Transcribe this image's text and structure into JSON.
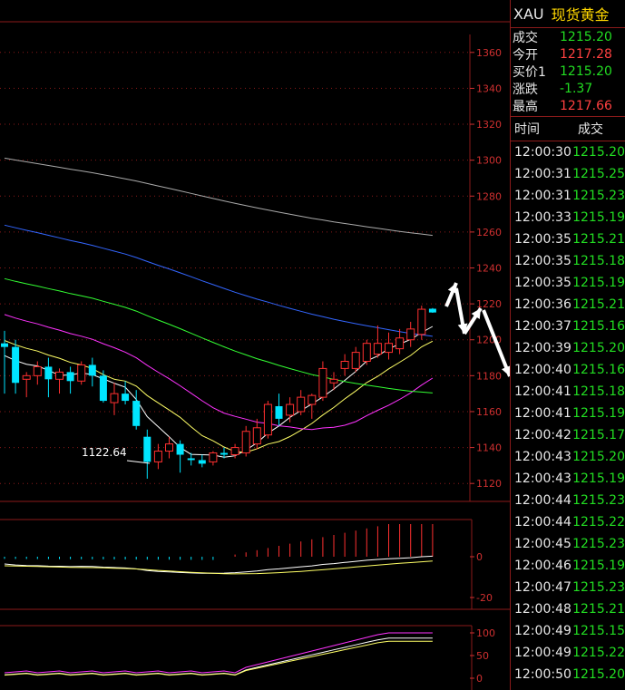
{
  "chart": {
    "price_ticks": [
      "1360",
      "1340",
      "1320",
      "1300",
      "1280",
      "1260",
      "1240",
      "1220",
      "1200",
      "1180",
      "1160",
      "1140",
      "1120"
    ],
    "low_label": "1122.64",
    "macd_ticks": [
      "0",
      "-20"
    ],
    "kdj_ticks": [
      "100",
      "50",
      "0"
    ]
  },
  "chart_data": {
    "type": "candlestick",
    "price_range": [
      1110,
      1370
    ],
    "candles": [
      {
        "o": 1198,
        "h": 1205,
        "l": 1170,
        "c": 1196
      },
      {
        "o": 1196,
        "h": 1200,
        "l": 1170,
        "c": 1176
      },
      {
        "o": 1178,
        "h": 1182,
        "l": 1168,
        "c": 1180
      },
      {
        "o": 1180,
        "h": 1188,
        "l": 1175,
        "c": 1185
      },
      {
        "o": 1185,
        "h": 1190,
        "l": 1168,
        "c": 1178
      },
      {
        "o": 1178,
        "h": 1184,
        "l": 1170,
        "c": 1182
      },
      {
        "o": 1182,
        "h": 1185,
        "l": 1170,
        "c": 1177
      },
      {
        "o": 1177,
        "h": 1188,
        "l": 1175,
        "c": 1186
      },
      {
        "o": 1186,
        "h": 1190,
        "l": 1174,
        "c": 1180
      },
      {
        "o": 1180,
        "h": 1183,
        "l": 1165,
        "c": 1166
      },
      {
        "o": 1165,
        "h": 1176,
        "l": 1158,
        "c": 1170
      },
      {
        "o": 1170,
        "h": 1177,
        "l": 1164,
        "c": 1166
      },
      {
        "o": 1166,
        "h": 1172,
        "l": 1150,
        "c": 1152
      },
      {
        "o": 1146,
        "h": 1150,
        "l": 1122.64,
        "c": 1132
      },
      {
        "o": 1132,
        "h": 1142,
        "l": 1128,
        "c": 1138
      },
      {
        "o": 1138,
        "h": 1146,
        "l": 1134,
        "c": 1142
      },
      {
        "o": 1142,
        "h": 1144,
        "l": 1126,
        "c": 1136
      },
      {
        "o": 1134,
        "h": 1137,
        "l": 1130,
        "c": 1133
      },
      {
        "o": 1133,
        "h": 1136,
        "l": 1129,
        "c": 1131
      },
      {
        "o": 1132,
        "h": 1138,
        "l": 1130,
        "c": 1137
      },
      {
        "o": 1137,
        "h": 1140,
        "l": 1134,
        "c": 1136
      },
      {
        "o": 1136,
        "h": 1142,
        "l": 1134,
        "c": 1140
      },
      {
        "o": 1137,
        "h": 1152,
        "l": 1135,
        "c": 1149
      },
      {
        "o": 1142,
        "h": 1156,
        "l": 1139,
        "c": 1151
      },
      {
        "o": 1147,
        "h": 1166,
        "l": 1145,
        "c": 1164
      },
      {
        "o": 1163,
        "h": 1170,
        "l": 1152,
        "c": 1156
      },
      {
        "o": 1158,
        "h": 1168,
        "l": 1154,
        "c": 1164
      },
      {
        "o": 1160,
        "h": 1172,
        "l": 1158,
        "c": 1168
      },
      {
        "o": 1164,
        "h": 1170,
        "l": 1156,
        "c": 1169
      },
      {
        "o": 1168,
        "h": 1188,
        "l": 1166,
        "c": 1184
      },
      {
        "o": 1176,
        "h": 1182,
        "l": 1172,
        "c": 1178
      },
      {
        "o": 1184,
        "h": 1192,
        "l": 1180,
        "c": 1188
      },
      {
        "o": 1184,
        "h": 1196,
        "l": 1182,
        "c": 1193
      },
      {
        "o": 1188,
        "h": 1200,
        "l": 1186,
        "c": 1198
      },
      {
        "o": 1192,
        "h": 1208,
        "l": 1190,
        "c": 1198
      },
      {
        "o": 1193,
        "h": 1204,
        "l": 1189,
        "c": 1198
      },
      {
        "o": 1195,
        "h": 1206,
        "l": 1192,
        "c": 1201
      },
      {
        "o": 1200,
        "h": 1210,
        "l": 1196,
        "c": 1206
      },
      {
        "o": 1203,
        "h": 1219,
        "l": 1200,
        "c": 1217
      },
      {
        "o": 1217.28,
        "h": 1217.66,
        "l": 1215,
        "c": 1215.2
      }
    ]
  },
  "quote": {
    "symbol": "XAU",
    "name": "现货黄金",
    "rows": [
      {
        "label": "成交",
        "value": "1215.20",
        "color": "#22dd22"
      },
      {
        "label": "今开",
        "value": "1217.28",
        "color": "#ff4040"
      },
      {
        "label": "买价1",
        "value": "1215.20",
        "color": "#22dd22"
      },
      {
        "label": "涨跌",
        "value": "-1.37",
        "color": "#22dd22"
      },
      {
        "label": "最高",
        "value": "1217.66",
        "color": "#ff4040"
      }
    ]
  },
  "ticks": {
    "headers": [
      "时间",
      "成交"
    ],
    "rows": [
      {
        "t": "12:00:30",
        "p": "1215.20"
      },
      {
        "t": "12:00:31",
        "p": "1215.25"
      },
      {
        "t": "12:00:31",
        "p": "1215.23"
      },
      {
        "t": "12:00:33",
        "p": "1215.19"
      },
      {
        "t": "12:00:35",
        "p": "1215.21"
      },
      {
        "t": "12:00:35",
        "p": "1215.18"
      },
      {
        "t": "12:00:35",
        "p": "1215.19"
      },
      {
        "t": "12:00:36",
        "p": "1215.21"
      },
      {
        "t": "12:00:37",
        "p": "1215.16"
      },
      {
        "t": "12:00:39",
        "p": "1215.20"
      },
      {
        "t": "12:00:40",
        "p": "1215.16"
      },
      {
        "t": "12:00:41",
        "p": "1215.18"
      },
      {
        "t": "12:00:41",
        "p": "1215.19"
      },
      {
        "t": "12:00:42",
        "p": "1215.17"
      },
      {
        "t": "12:00:43",
        "p": "1215.20"
      },
      {
        "t": "12:00:43",
        "p": "1215.19"
      },
      {
        "t": "12:00:44",
        "p": "1215.23"
      },
      {
        "t": "12:00:44",
        "p": "1215.22"
      },
      {
        "t": "12:00:45",
        "p": "1215.23"
      },
      {
        "t": "12:00:46",
        "p": "1215.19"
      },
      {
        "t": "12:00:47",
        "p": "1215.23"
      },
      {
        "t": "12:00:48",
        "p": "1215.21"
      },
      {
        "t": "12:00:49",
        "p": "1215.15"
      },
      {
        "t": "12:00:49",
        "p": "1215.22"
      },
      {
        "t": "12:00:50",
        "p": "1215.20"
      }
    ]
  },
  "colors": {
    "up": "#ff3030",
    "down": "#00e5ff",
    "grid": "#8b1a1a",
    "axis": "#d03030"
  }
}
